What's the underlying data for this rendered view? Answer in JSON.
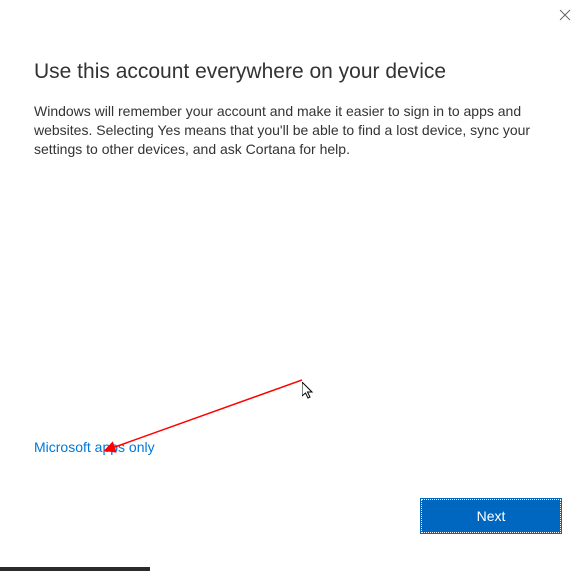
{
  "dialog": {
    "close_label": "Close",
    "title": "Use this account everywhere on your device",
    "body": "Windows will remember your account and make it easier to sign in to apps and websites. Selecting Yes means that you'll be able to find a lost device, sync your settings to other devices, and ask Cortana for help.",
    "apps_only_link": "Microsoft apps only",
    "next_button": "Next"
  },
  "colors": {
    "accent": "#0067c0",
    "link": "#0078d7",
    "annotation": "#ff0000"
  }
}
